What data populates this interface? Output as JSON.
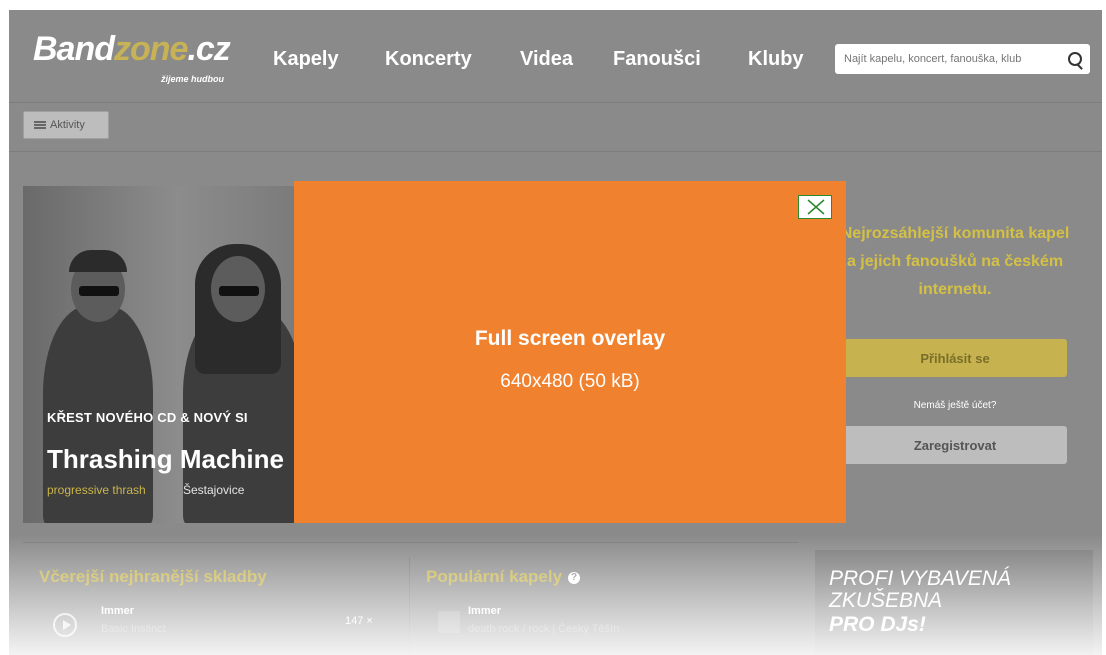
{
  "header": {
    "logo_band": "Band",
    "logo_zone": "zone",
    "logo_tld": ".cz",
    "tagline": "žijeme hudbou",
    "nav": [
      "Kapely",
      "Koncerty",
      "Videa",
      "Fanoušci",
      "Kluby"
    ],
    "search_placeholder": "Najít kapelu, koncert, fanouška, klub"
  },
  "subbar": {
    "activity_label": "Aktivity"
  },
  "hero": {
    "subtitle": "KŘEST NOVÉHO CD & NOVÝ SI",
    "title": "Thrashing Machine",
    "genre": "progressive thrash",
    "place": "Šestajovice"
  },
  "sidebar": {
    "tagline": "Nejrozsáhlejší komunita kapel a jejich fanoušků na českém internetu.",
    "login_label": "Přihlásit se",
    "no_account": "Nemáš ještě účet?",
    "register_label": "Zaregistrovat"
  },
  "sections": {
    "top_tracks_title": "Včerejší nejhranější skladby",
    "track_artist": "Immer",
    "track_name": "Basic Instinct",
    "track_count": "147 ×",
    "popular_title": "Populární kapely",
    "popular_band": "Immer",
    "popular_band_info": "death rock / rock | Český Těšín",
    "help_symbol": "?"
  },
  "ad": {
    "line1": "PROFI VYBAVENÁ",
    "line2": "ZKUŠEBNA",
    "line3": "PRO DJs!"
  },
  "overlay": {
    "title": "Full screen overlay",
    "subtitle": "640x480 (50 kB)"
  },
  "colors": {
    "overlay": "#f0812e",
    "dimmed_bg": "#8a8a8a",
    "accent_yellow": "#d4c045"
  }
}
